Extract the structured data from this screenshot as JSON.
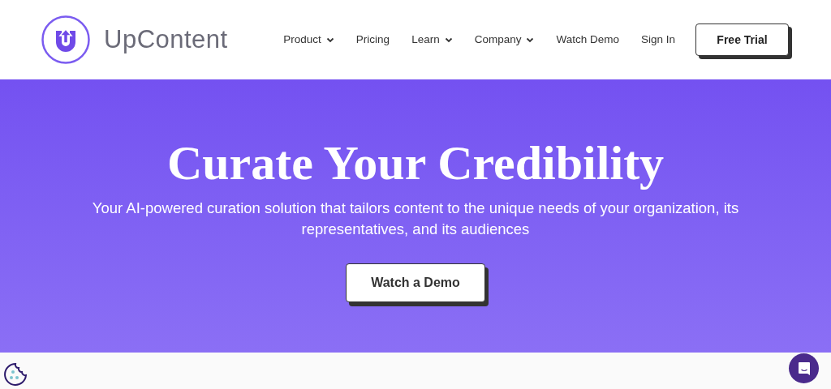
{
  "header": {
    "logo_text": "UpContent",
    "nav": [
      {
        "label": "Product",
        "dropdown": true
      },
      {
        "label": "Pricing",
        "dropdown": false
      },
      {
        "label": "Learn",
        "dropdown": true
      },
      {
        "label": "Company",
        "dropdown": true
      },
      {
        "label": "Watch Demo",
        "dropdown": false
      },
      {
        "label": "Sign In",
        "dropdown": false
      }
    ],
    "cta": "Free Trial"
  },
  "hero": {
    "title": "Curate Your Credibility",
    "subtitle": "Your AI-powered curation solution that tailors content to the unique needs of your organization, its representatives, and its audiences",
    "button": "Watch a Demo"
  }
}
